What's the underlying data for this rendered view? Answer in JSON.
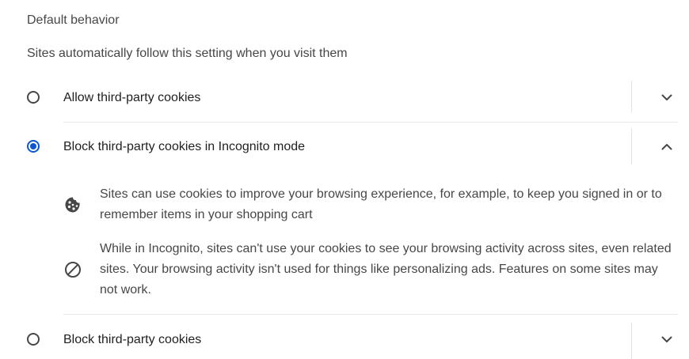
{
  "section": {
    "title": "Default behavior",
    "description": "Sites automatically follow this setting when you visit them"
  },
  "options": [
    {
      "label": "Allow third-party cookies",
      "checked": false,
      "expanded": false
    },
    {
      "label": "Block third-party cookies in Incognito mode",
      "checked": true,
      "expanded": true,
      "details": [
        {
          "icon": "cookie-icon",
          "text": "Sites can use cookies to improve your browsing experience, for example, to keep you signed in or to remember items in your shopping cart"
        },
        {
          "icon": "block-icon",
          "text": "While in Incognito, sites can't use your cookies to see your browsing activity across sites, even related sites. Your browsing activity isn't used for things like personalizing ads. Features on some sites may not work."
        }
      ]
    },
    {
      "label": "Block third-party cookies",
      "checked": false,
      "expanded": false
    }
  ],
  "colors": {
    "accent": "#0b57d0",
    "text_primary": "#1f1f1f",
    "text_secondary": "#474747",
    "divider": "#e3e3e3"
  }
}
